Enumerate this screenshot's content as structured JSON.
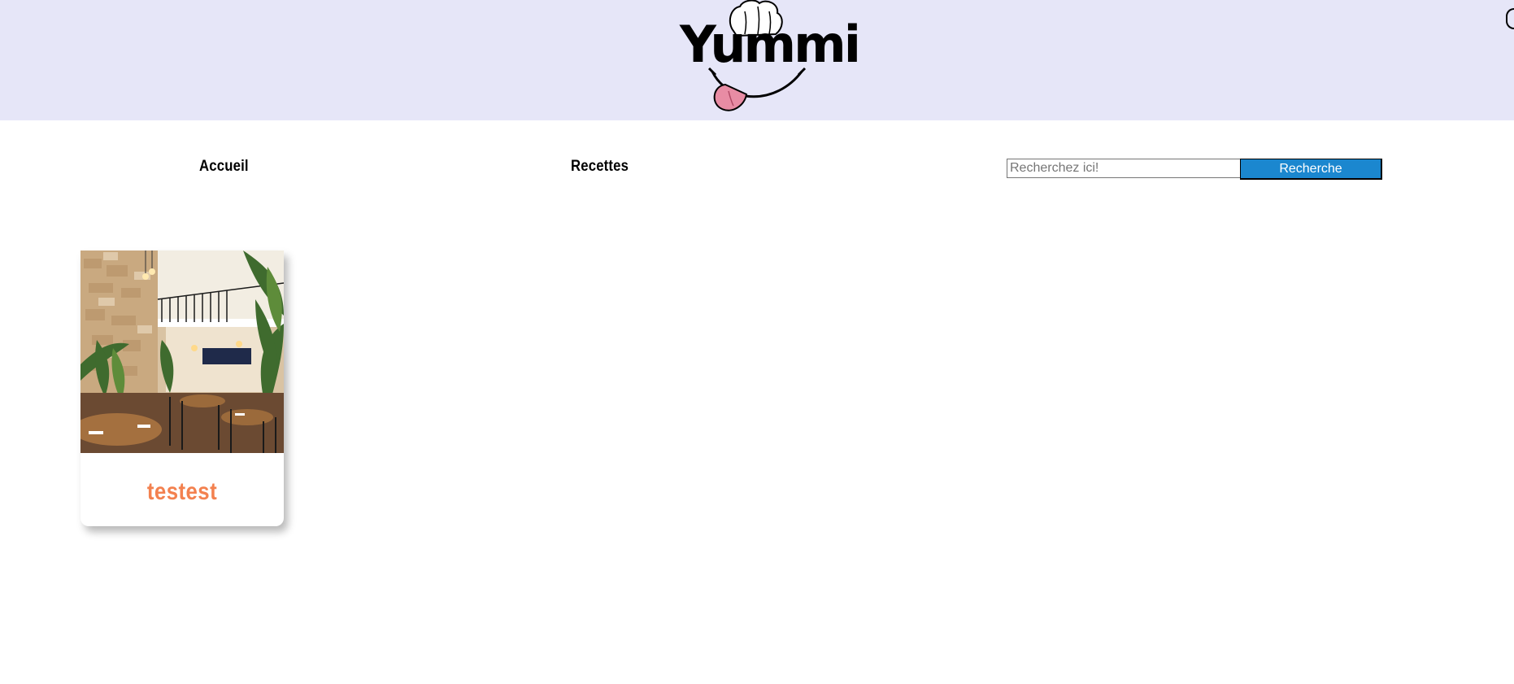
{
  "header": {
    "logo_text": "Yummi",
    "background": "#e6e6f8"
  },
  "nav": {
    "items": [
      {
        "label": "Accueil"
      },
      {
        "label": "Recettes"
      }
    ]
  },
  "search": {
    "placeholder": "Recherchez ici!",
    "value": "",
    "button_label": "Recherche",
    "button_color": "#1b87cf"
  },
  "recipes": [
    {
      "title": "testest",
      "image": "restaurant-interior-photo",
      "title_color": "#f3814f"
    }
  ]
}
